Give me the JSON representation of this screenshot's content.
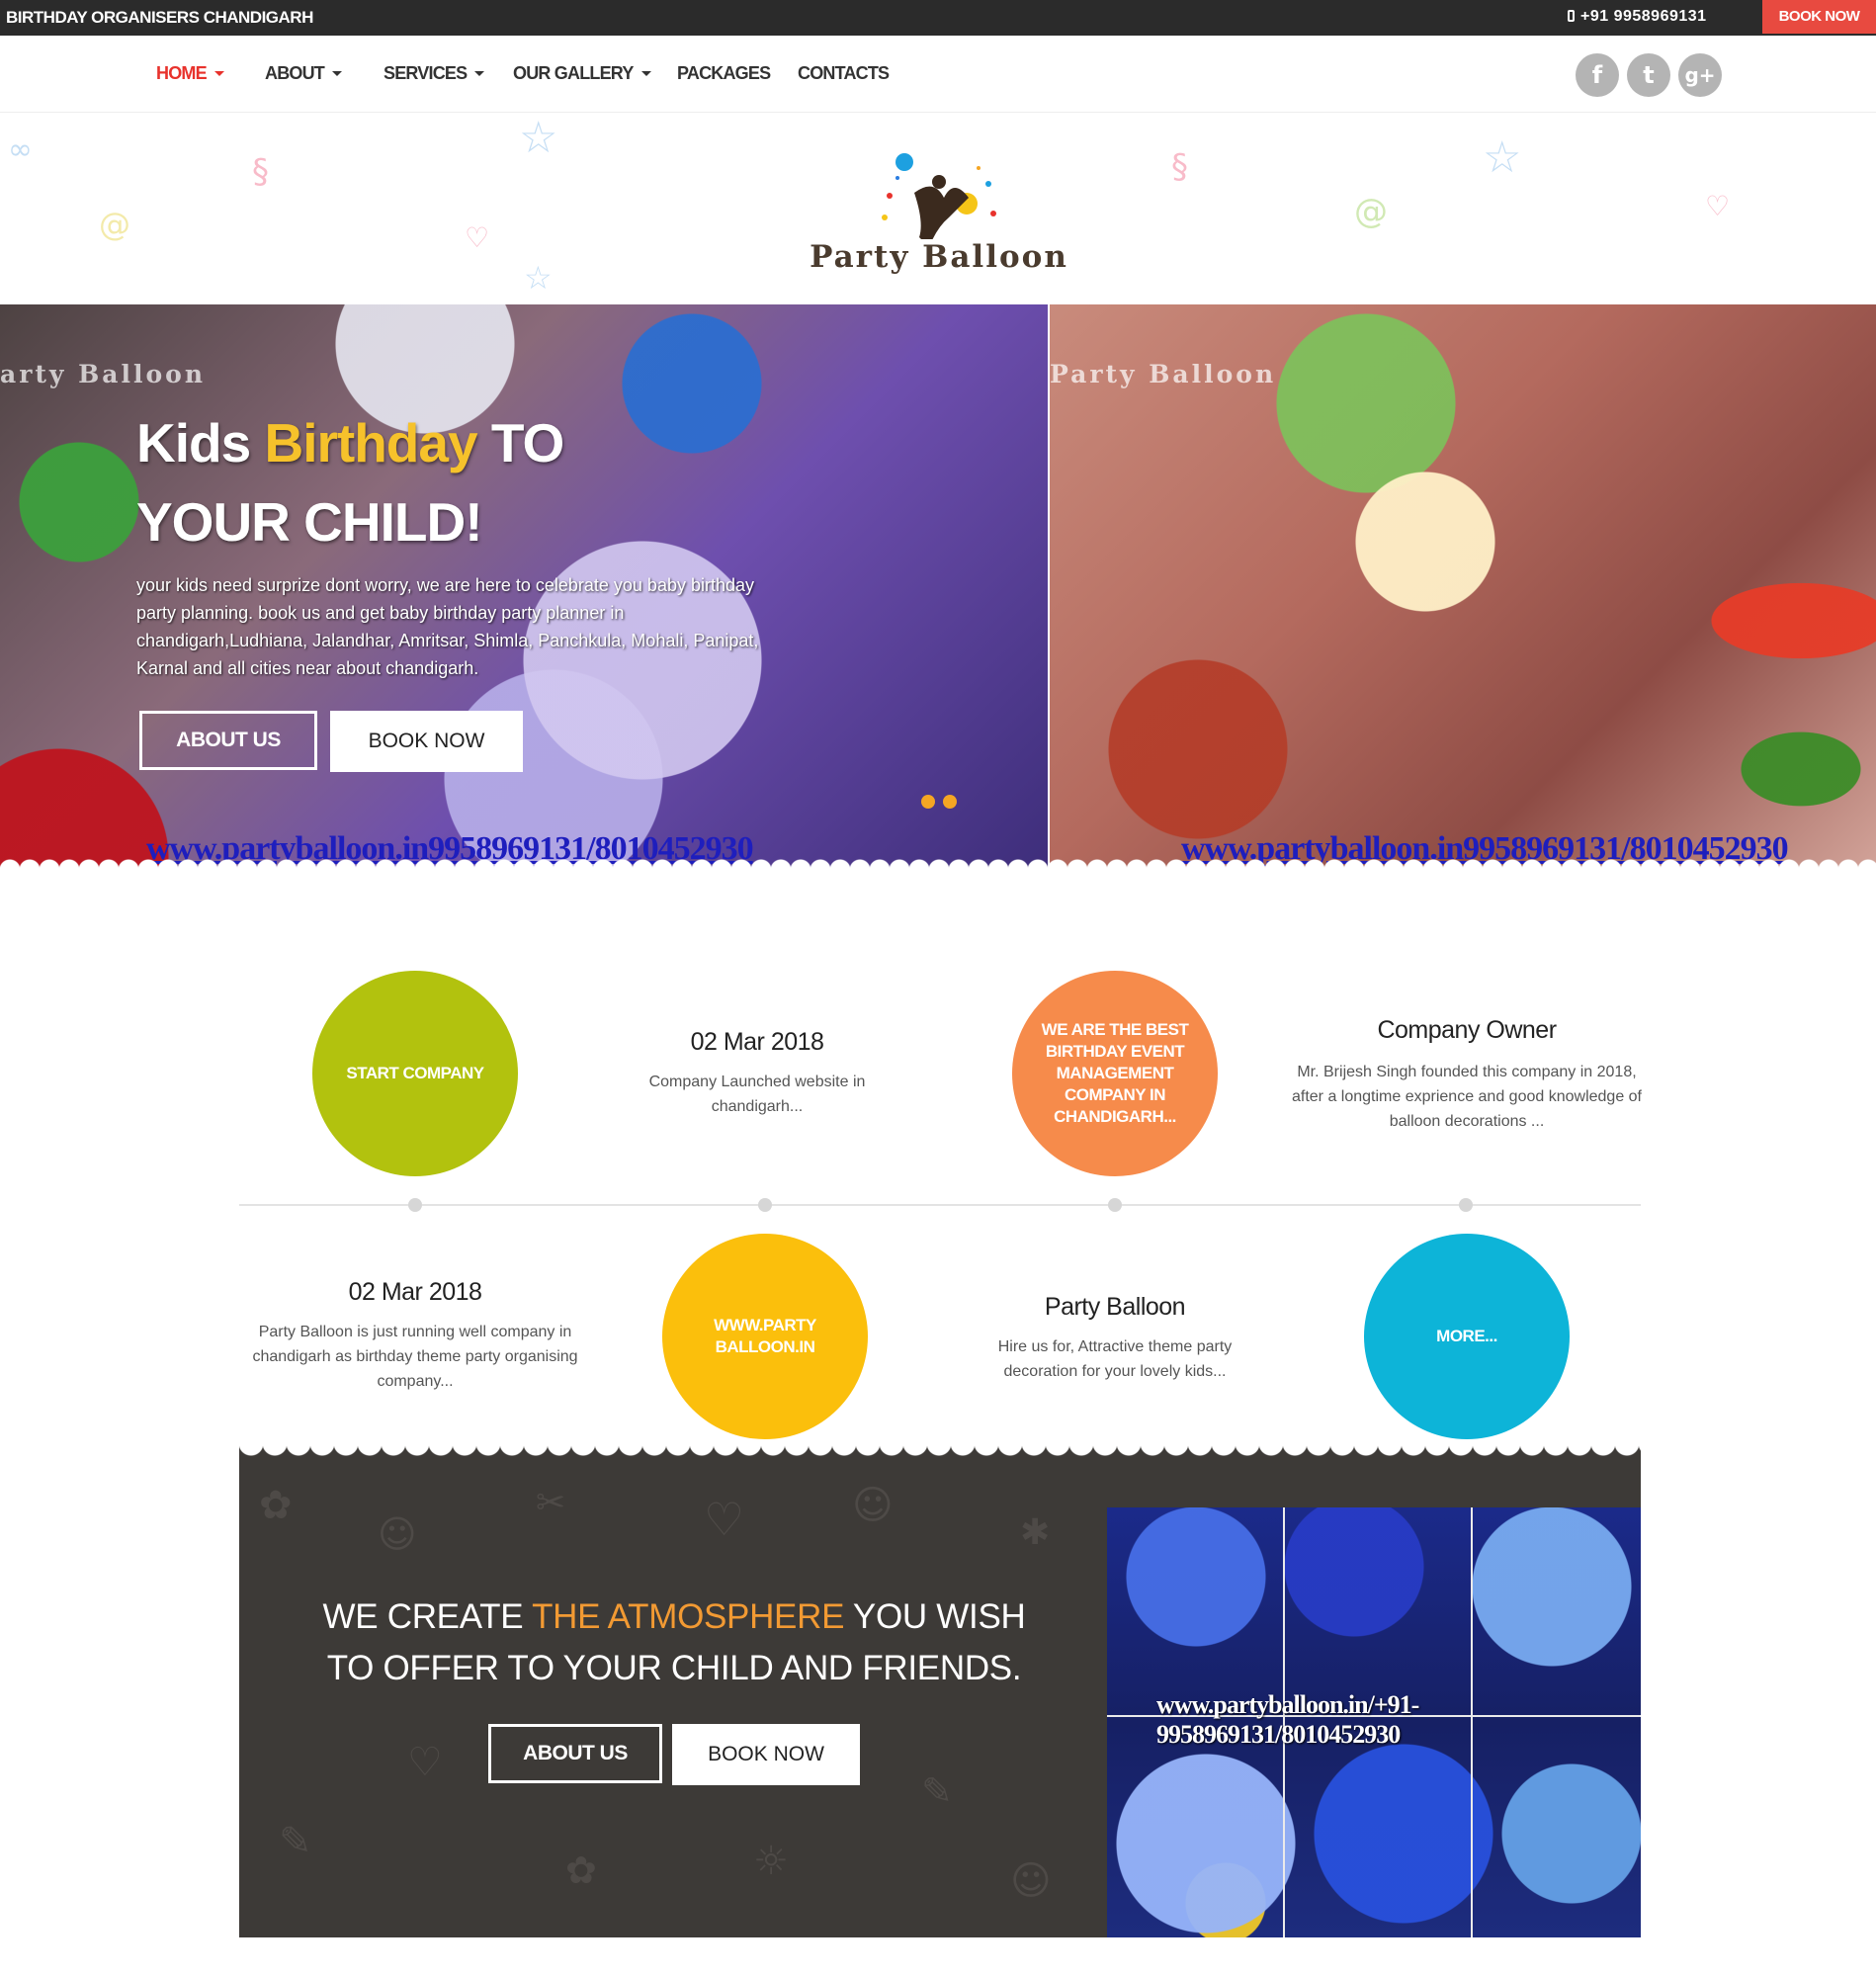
{
  "topbar": {
    "brand": "BIRTHDAY ORGANISERS CHANDIGARH",
    "phone": "+91 9958969131",
    "book_now": "BOOK NOW"
  },
  "nav": {
    "items": [
      {
        "label": "HOME",
        "dropdown": true,
        "active": true
      },
      {
        "label": "ABOUT",
        "dropdown": true
      },
      {
        "label": "SERVICES",
        "dropdown": true
      },
      {
        "label": "OUR GALLERY",
        "dropdown": true
      },
      {
        "label": "PACKAGES",
        "dropdown": false
      },
      {
        "label": "CONTACTS",
        "dropdown": false
      }
    ],
    "social": [
      {
        "icon": "facebook-icon",
        "glyph": "f"
      },
      {
        "icon": "twitter-icon",
        "glyph": "t"
      },
      {
        "icon": "google-plus-icon",
        "glyph": "g+"
      }
    ]
  },
  "logo": {
    "title": "Party Balloon"
  },
  "hero": {
    "watermark_left": "arty Balloon",
    "watermark_right": "Party Balloon",
    "title_part1": "Kids ",
    "title_highlight": "Birthday",
    "title_part2": " TO",
    "title_line2": "YOUR CHILD!",
    "description": "your kids need surprize dont worry, we are here to celebrate you baby birthday party planning. book us and get baby birthday party planner in chandigarh,Ludhiana, Jalandhar, Amritsar, Shimla, Panchkula, Mohali, Panipat, Karnal and all cities near about chandigarh.",
    "about_button": "ABOUT US",
    "book_button": "BOOK NOW",
    "url_strip_left": "www.partyballoon.in9958969131/8010452930",
    "url_strip_right": "www.partyballoon.in9958969131/8010452930"
  },
  "timeline": {
    "top": [
      {
        "type": "circle",
        "label": "START COMPANY",
        "color": "#b2c20e"
      },
      {
        "type": "text",
        "title": "02 Mar 2018",
        "text": "Company Launched website in chandigarh..."
      },
      {
        "type": "circle",
        "label": "WE ARE THE BEST BIRTHDAY EVENT MANAGEMENT COMPANY IN CHANDIGARH...",
        "color": "#f68b4b"
      },
      {
        "type": "text",
        "title": "Company Owner",
        "text": "Mr. Brijesh Singh founded this company in 2018, after a longtime exprience and good knowledge of balloon decorations ..."
      }
    ],
    "bottom": [
      {
        "type": "text",
        "title": "02 Mar 2018",
        "text": "Party Balloon is just running well company in chandigarh as birthday theme party organising company..."
      },
      {
        "type": "circle",
        "label": "WWW.PARTY BALLOON.IN",
        "color": "#fbbf0c"
      },
      {
        "type": "text",
        "title": "Party Balloon",
        "text": "Hire us for, Attractive theme party decoration for your lovely kids..."
      },
      {
        "type": "circle",
        "label": "MORE...",
        "color": "#0db4d8"
      }
    ]
  },
  "atmosphere": {
    "line1_a": "WE CREATE ",
    "line1_highlight": "THE ATMOSPHERE",
    "line1_b": " YOU WISH",
    "line2": "TO OFFER TO YOUR CHILD AND FRIENDS.",
    "about_button": "ABOUT US",
    "book_button": "BOOK NOW",
    "photo_watermark": "www.partyballoon.in/+91-9958969131/8010452930"
  },
  "colors": {
    "accent_red": "#e84a40",
    "nav_active": "#e8322c",
    "highlight_yellow": "#f6c22b",
    "highlight_orange": "#f29a33",
    "dark_block": "#3d3a37"
  }
}
